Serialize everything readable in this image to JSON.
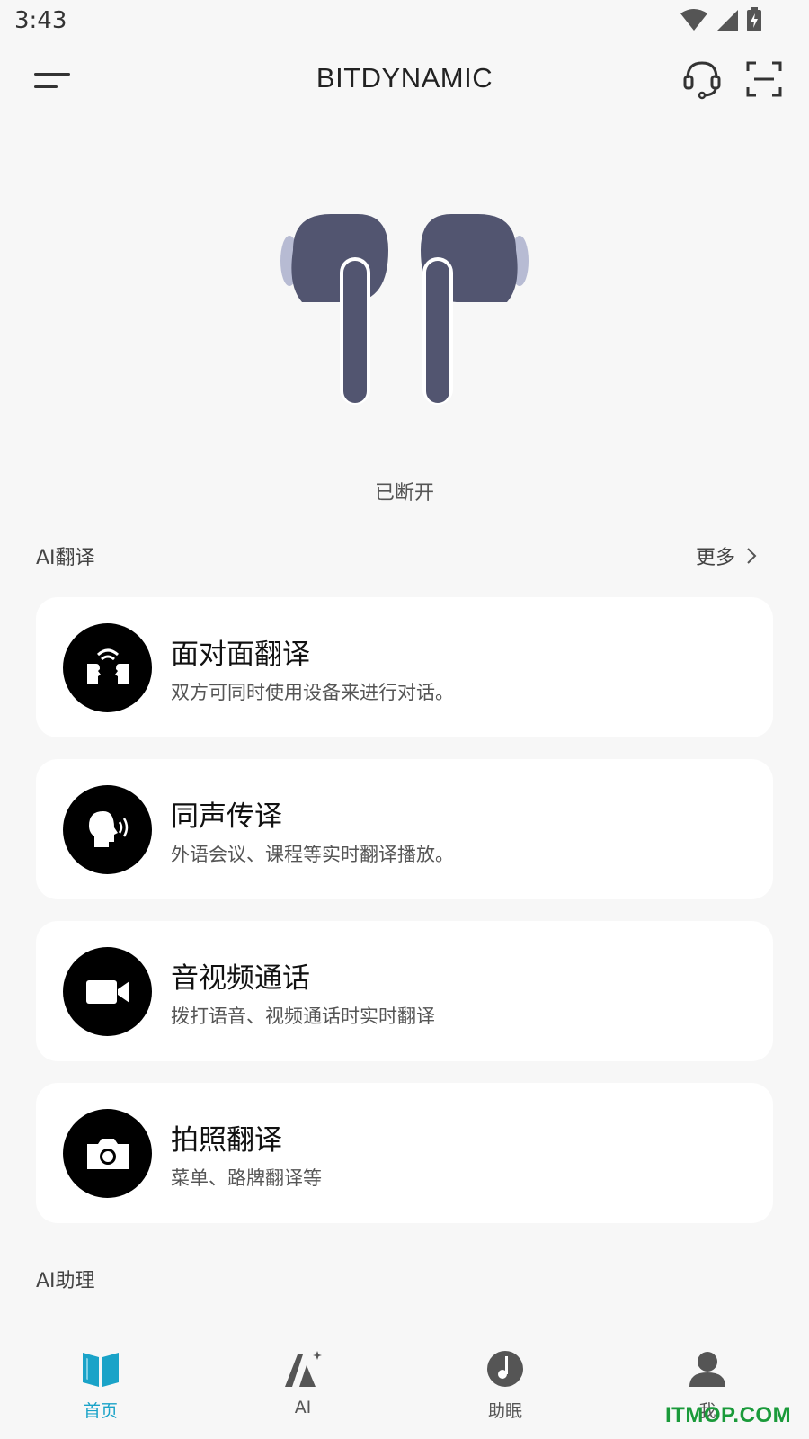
{
  "status_bar": {
    "time": "3:43"
  },
  "app_bar": {
    "title": "BITDYNAMIC"
  },
  "device": {
    "status": "已断开"
  },
  "translation": {
    "section_title": "AI翻译",
    "more_label": "更多",
    "cards": [
      {
        "title": "面对面翻译",
        "desc": "双方可同时使用设备来进行对话。",
        "icon": "face-to-face-icon"
      },
      {
        "title": "同声传译",
        "desc": "外语会议、课程等实时翻译播放。",
        "icon": "speaking-head-icon"
      },
      {
        "title": "音视频通话",
        "desc": "拨打语音、视频通话时实时翻译",
        "icon": "video-camera-icon"
      },
      {
        "title": "拍照翻译",
        "desc": "菜单、路牌翻译等",
        "icon": "camera-icon"
      }
    ]
  },
  "assistant": {
    "section_title": "AI助理"
  },
  "bottom_nav": {
    "items": [
      {
        "label": "首页",
        "icon": "book-icon",
        "active": true
      },
      {
        "label": "AI",
        "icon": "ai-sparkle-icon",
        "active": false
      },
      {
        "label": "助眠",
        "icon": "sleep-music-icon",
        "active": false
      },
      {
        "label": "我",
        "icon": "user-icon",
        "active": false
      }
    ]
  },
  "watermark": "ITMOP.COM",
  "colors": {
    "accent": "#1aa3c8",
    "earbud": "#525570",
    "earbud_tip": "#b7bbd3",
    "background": "#f7f7f7"
  }
}
